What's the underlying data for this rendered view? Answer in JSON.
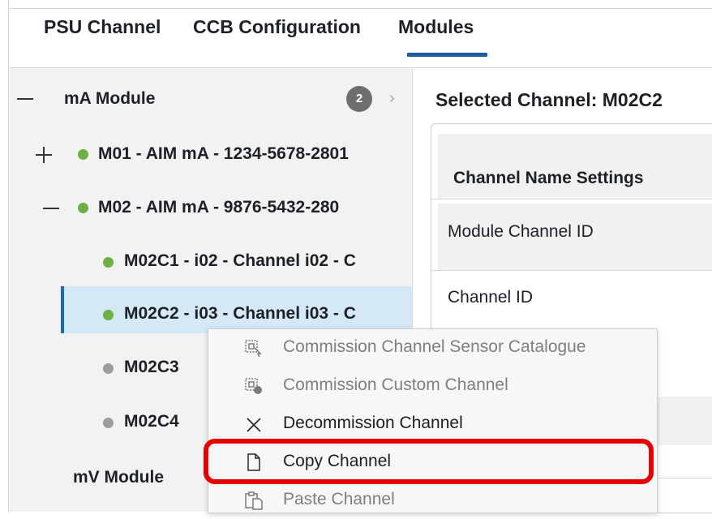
{
  "tabs": [
    {
      "label": "PSU Channel",
      "active": false
    },
    {
      "label": "CCB Configuration",
      "active": false
    },
    {
      "label": "Modules",
      "active": true
    }
  ],
  "tree": {
    "group1": {
      "label": "mA Module",
      "count": "2",
      "expanded": true
    },
    "modules": [
      {
        "label": "M01 - AIM mA - 1234-5678-2801",
        "status": "green",
        "expanded": false
      },
      {
        "label": "M02 - AIM mA - 9876-5432-280",
        "status": "green",
        "expanded": true
      }
    ],
    "channels": [
      {
        "label": "M02C1 - i02 - Channel i02 - C",
        "status": "green",
        "selected": false
      },
      {
        "label": "M02C2 - i03 - Channel i03 - C",
        "status": "green",
        "selected": true
      },
      {
        "label": "M02C3",
        "status": "grey",
        "selected": false
      },
      {
        "label": "M02C4",
        "status": "grey",
        "selected": false
      }
    ],
    "group2": {
      "label": "mV Module"
    }
  },
  "right_panel": {
    "title": "Selected Channel: M02C2",
    "section_title": "Channel Name Settings",
    "fields": [
      "Module Channel ID",
      "Channel ID"
    ]
  },
  "context_menu": {
    "items": [
      {
        "label": "Commission Channel Sensor Catalogue",
        "icon": "commission-catalogue-icon",
        "enabled": false
      },
      {
        "label": "Commission Custom Channel",
        "icon": "commission-custom-icon",
        "enabled": false
      },
      {
        "label": "Decommission Channel",
        "icon": "close-x-icon",
        "enabled": true
      },
      {
        "label": "Copy Channel",
        "icon": "document-icon",
        "enabled": true,
        "highlighted": true
      },
      {
        "label": "Paste Channel",
        "icon": "paste-icon",
        "enabled": false
      }
    ]
  },
  "colors": {
    "accent": "#1c5f9b",
    "selection": "#d4e8f6",
    "status_green": "#6eb043",
    "status_grey": "#9d9d9d",
    "highlight_red": "#e60000"
  }
}
